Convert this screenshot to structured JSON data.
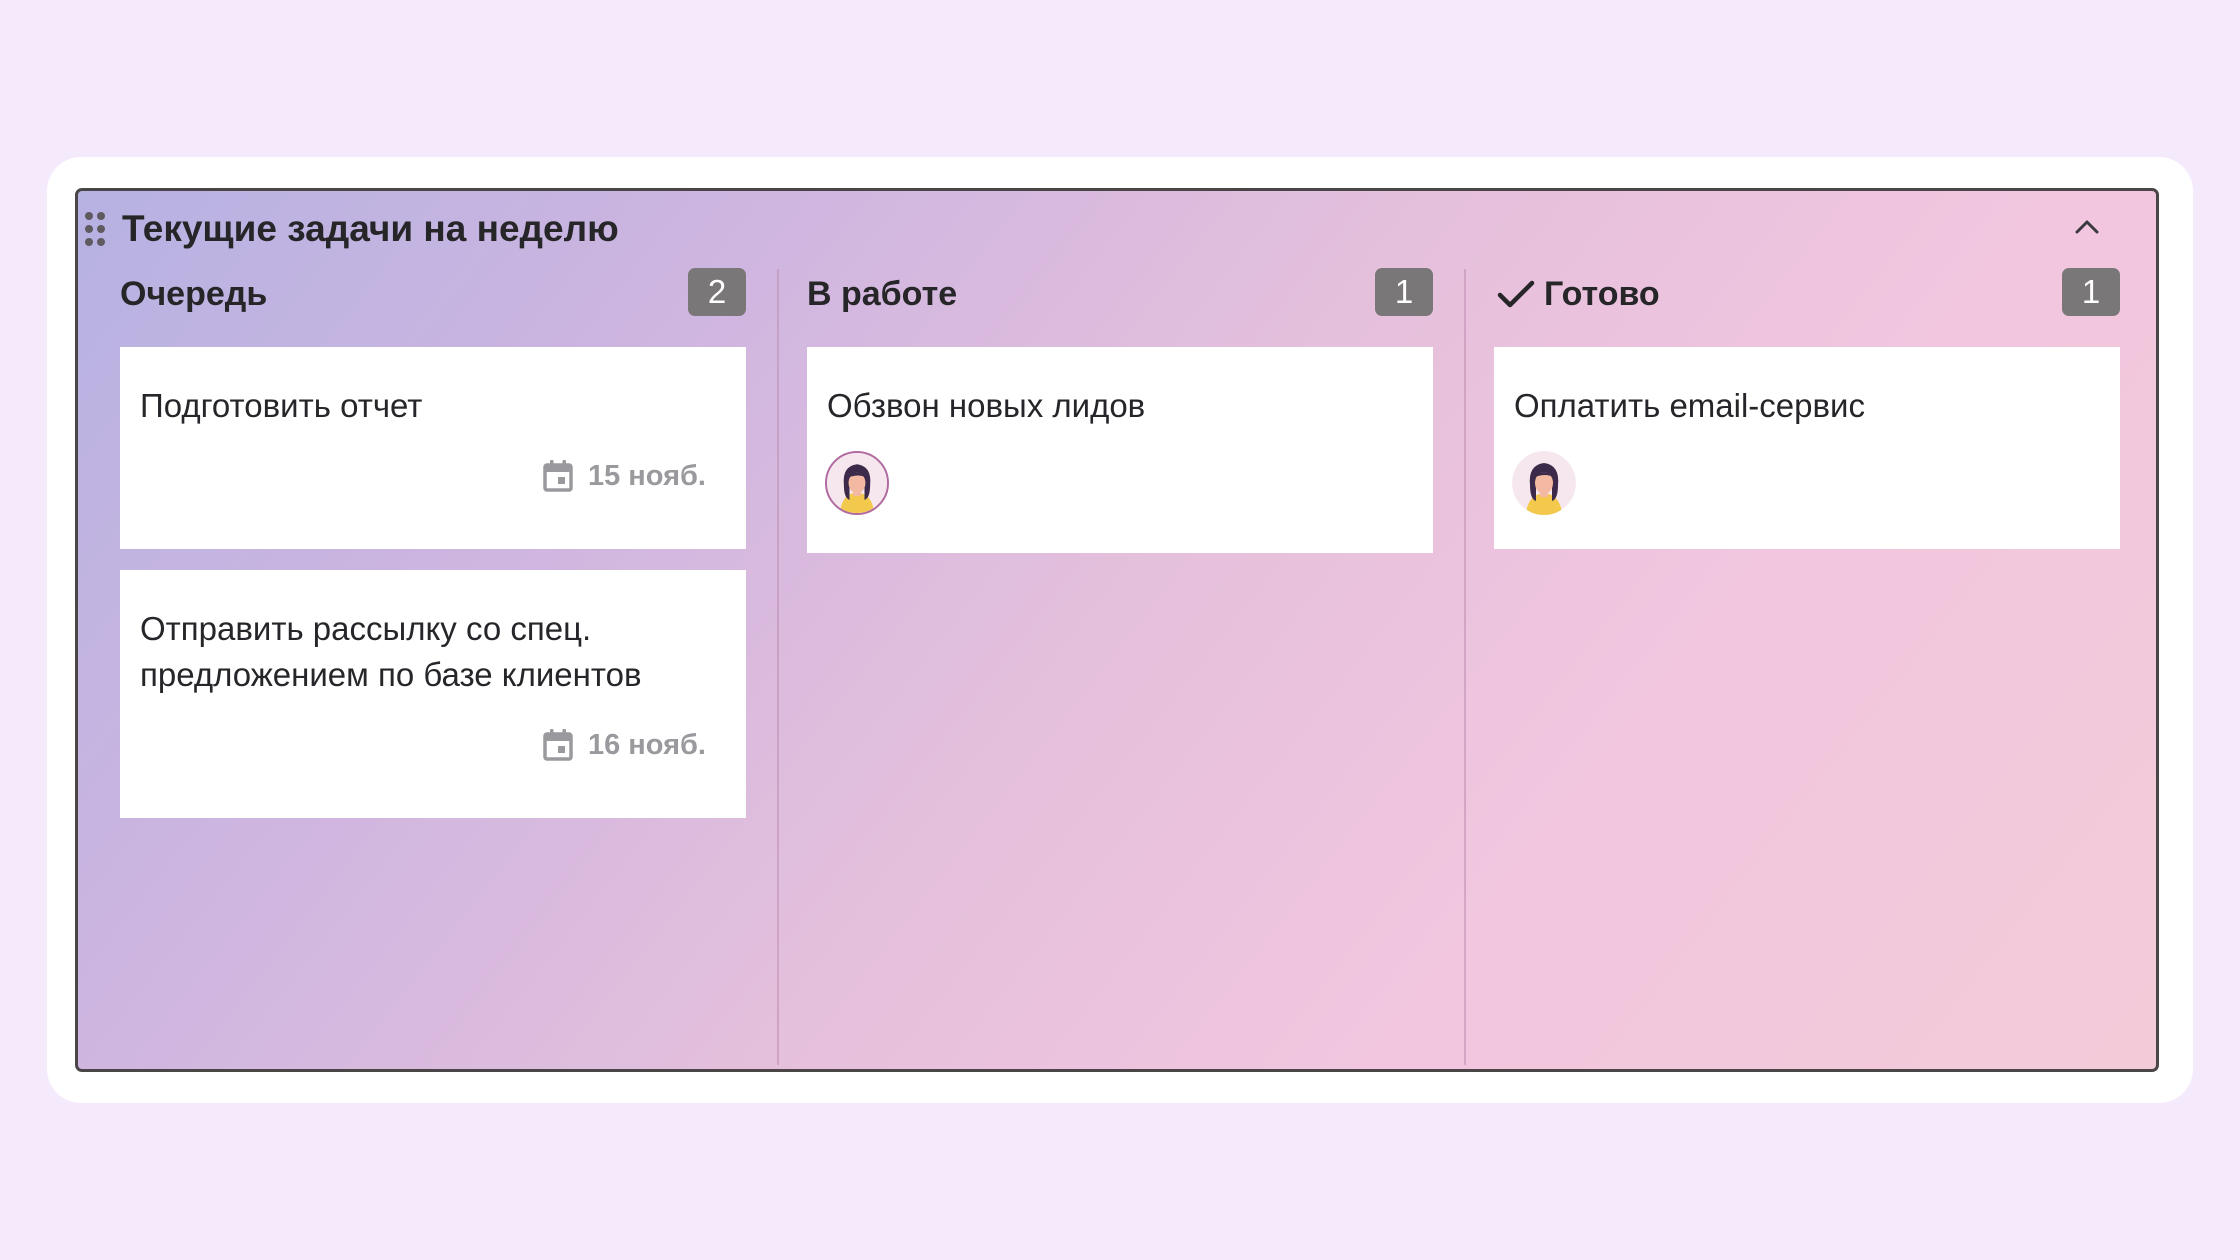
{
  "board": {
    "title": "Текущие задачи на неделю"
  },
  "icons": {
    "drag": "drag-handle-icon",
    "collapse": "chevron-up-icon",
    "done": "check-icon",
    "calendar": "calendar-icon",
    "avatar": "user-avatar"
  },
  "colors": {
    "badge": "#7a7779",
    "card": "#ffffff",
    "due_text": "#9a9a9e"
  },
  "columns": [
    {
      "title": "Очередь",
      "count": "2",
      "cards": [
        {
          "title": "Подготовить отчет",
          "due": "15 нояб."
        },
        {
          "title": "Отправить рассылку со спец. предложением по базе клиентов",
          "due": "16 нояб."
        }
      ]
    },
    {
      "title": "В работе",
      "count": "1",
      "cards": [
        {
          "title": "Обзвон новых лидов",
          "assignee": "avatar"
        }
      ]
    },
    {
      "title": "Готово",
      "count": "1",
      "cards": [
        {
          "title": "Оплатить email-сервис",
          "assignee": "avatar"
        }
      ]
    }
  ]
}
